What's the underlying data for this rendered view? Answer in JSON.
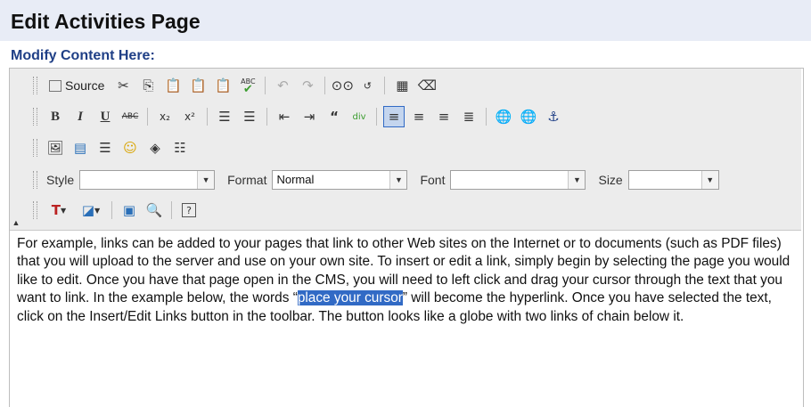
{
  "page": {
    "title": "Edit Activities Page",
    "section_label": "Modify Content Here:"
  },
  "toolbar": {
    "row1": {
      "source_label": "Source",
      "spellcheck_label": "ABC"
    },
    "row2": {
      "bold": "B",
      "italic": "I",
      "underline": "U",
      "strike": "ABC",
      "subscript": "x₂",
      "superscript": "x²"
    },
    "row4": {
      "style_label": "Style",
      "style_value": "",
      "format_label": "Format",
      "format_value": "Normal",
      "font_label": "Font",
      "font_value": "",
      "size_label": "Size",
      "size_value": ""
    },
    "row5": {
      "help_label": "?"
    }
  },
  "content": {
    "text_before": "For example, links can be added to your pages that link to other Web sites on the Internet or to documents (such as PDF files) that you will upload to the server and use on your own site. To insert or edit a link, simply begin by selecting the page you would like to edit.  Once you have that page open in the CMS, you will need to left click and drag your cursor through the text that you want to link.  In the example below, the words “",
    "highlighted": "place your cursor",
    "text_after": "” will become the hyperlink.  Once you have selected the text, click on the Insert/Edit Links button in the toolbar.  The button looks like a globe with two links of chain below it."
  },
  "colors": {
    "header_bg": "#e8ecf6",
    "section_label": "#1f3f86",
    "selection": "#316ac5"
  }
}
